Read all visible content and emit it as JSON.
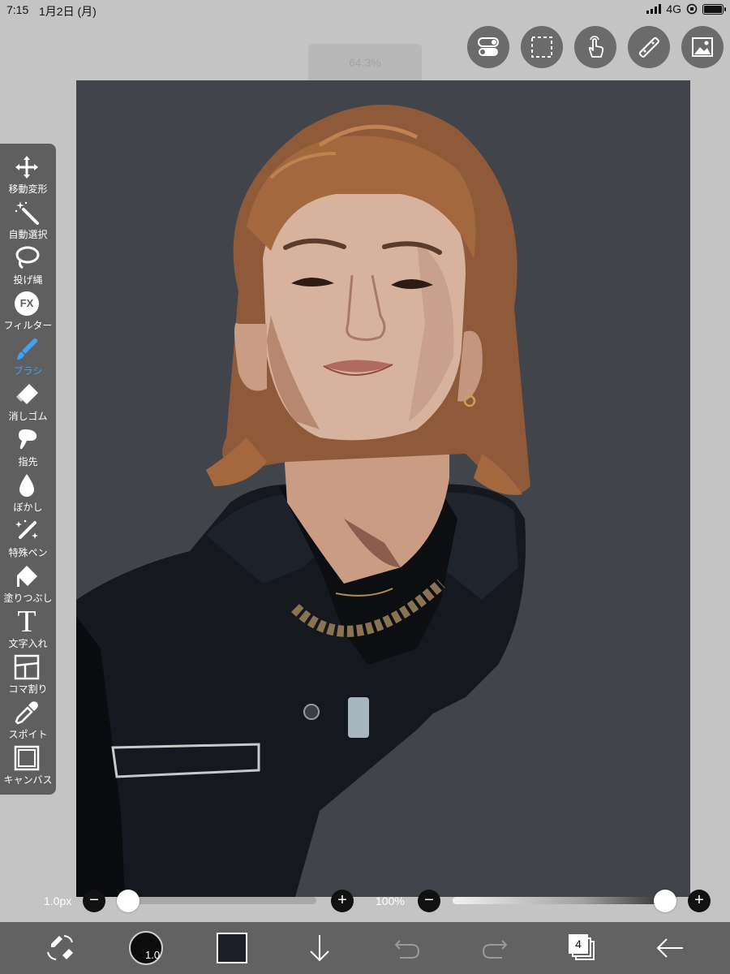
{
  "status_bar": {
    "time": "7:15",
    "date": "1月2日 (月)",
    "network": "4G"
  },
  "top_buttons": [
    "toggle-icon",
    "selection-icon",
    "hand-icon",
    "ruler-icon",
    "image-icon"
  ],
  "zoom_indicator": "64.3%",
  "tools": [
    {
      "label": "移動変形",
      "icon": "move-icon"
    },
    {
      "label": "自動選択",
      "icon": "magic-wand-icon"
    },
    {
      "label": "投げ縄",
      "icon": "lasso-icon"
    },
    {
      "label": "フィルター",
      "icon": "fx-icon",
      "badge": "FX"
    },
    {
      "label": "ブラシ",
      "icon": "brush-icon",
      "active": true
    },
    {
      "label": "消しゴム",
      "icon": "eraser-icon"
    },
    {
      "label": "指先",
      "icon": "finger-icon"
    },
    {
      "label": "ぼかし",
      "icon": "drop-icon"
    },
    {
      "label": "特殊ペン",
      "icon": "special-pen-icon"
    },
    {
      "label": "塗りつぶし",
      "icon": "fill-icon"
    },
    {
      "label": "文字入れ",
      "icon": "text-icon",
      "glyph": "T"
    },
    {
      "label": "コマ割り",
      "icon": "frame-divide-icon"
    },
    {
      "label": "スポイト",
      "icon": "eyedropper-icon"
    },
    {
      "label": "キャンバス",
      "icon": "canvas-icon"
    }
  ],
  "brush_size": {
    "value": "1.0px",
    "level": 0.0
  },
  "opacity": {
    "value": "100%",
    "level": 1.0
  },
  "bottom_bar": {
    "brush_preview_size": "1.0",
    "current_color": "#1c1e28",
    "layer_count": "4"
  },
  "colors": {
    "active": "#3fa2f2",
    "canvas_bg": "#41444a",
    "toolbar": "#5f5f5f"
  }
}
